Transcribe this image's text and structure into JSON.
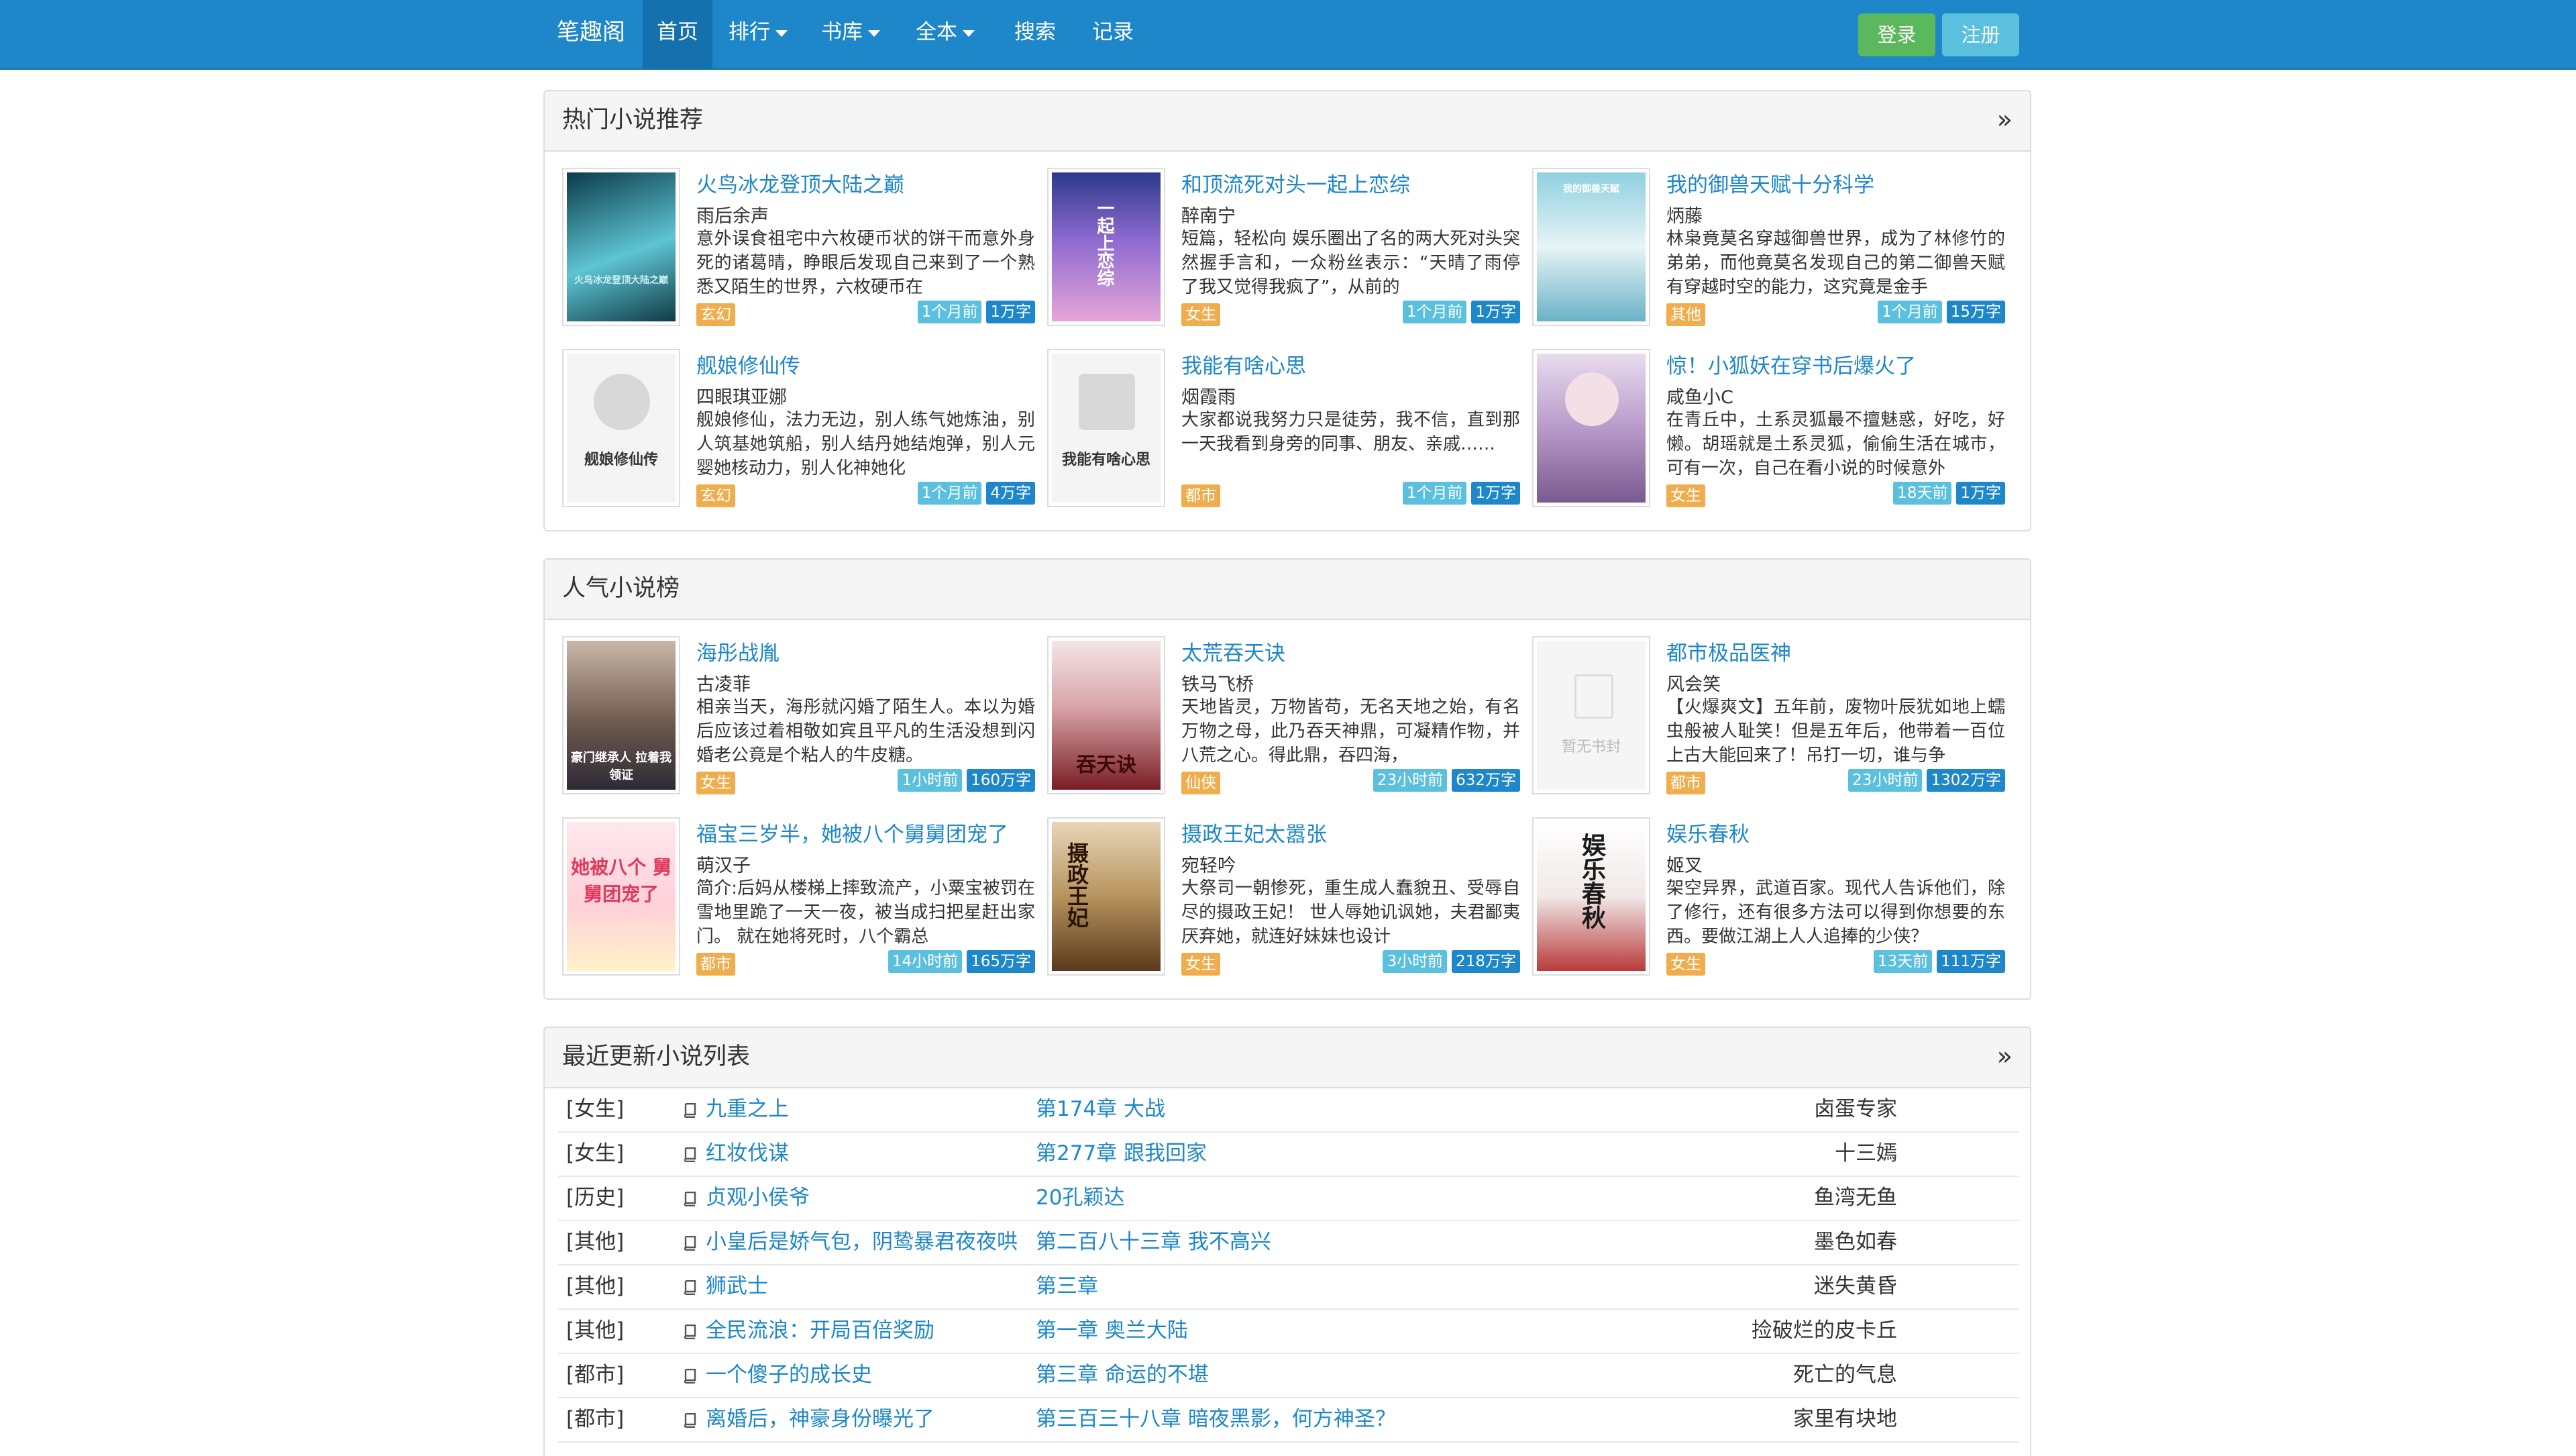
{
  "nav": {
    "brand": "笔趣阁",
    "items": [
      {
        "label": "首页"
      },
      {
        "label": "排行"
      },
      {
        "label": "书库"
      },
      {
        "label": "全本"
      },
      {
        "label": "搜索"
      },
      {
        "label": "记录"
      }
    ],
    "login": "登录",
    "register": "注册"
  },
  "hot": {
    "title": "热门小说推荐",
    "more_icon": "double-chevron-right-icon",
    "books": [
      {
        "title": "火鸟冰龙登顶大陆之巅",
        "author": "雨后余声",
        "intro": "意外误食祖宅中六枚硬币状的饼干而意外身死的诸葛晴，睁眼后发现自己来到了一个熟悉又陌生的世界，六枚硬币在",
        "category": "玄幻",
        "time": "1个月前",
        "words": "1万字"
      },
      {
        "title": "和顶流死对头一起上恋综",
        "author": "醉南宁",
        "intro": "短篇，轻松向 娱乐圈出了名的两大死对头突然握手言和，一众粉丝表示：“天晴了雨停了我又觉得我疯了”，从前的",
        "category": "女生",
        "time": "1个月前",
        "words": "1万字"
      },
      {
        "title": "我的御兽天赋十分科学",
        "author": "炳藤",
        "intro": "林枭竟莫名穿越御兽世界，成为了林修竹的弟弟，而他竟莫名发现自己的第二御兽天赋有穿越时空的能力，这究竟是金手",
        "category": "其他",
        "time": "1个月前",
        "words": "15万字"
      },
      {
        "title": "舰娘修仙传",
        "author": "四眼琪亚娜",
        "intro": "舰娘修仙，法力无边，别人练气她炼油，别人筑基她筑船，别人结丹她结炮弹，别人元婴她核动力，别人化神她化",
        "category": "玄幻",
        "time": "1个月前",
        "words": "4万字"
      },
      {
        "title": "我能有啥心思",
        "author": "烟霞雨",
        "intro": "大家都说我努力只是徒劳，我不信，直到那一天我看到身旁的同事、朋友、亲戚……",
        "category": "都市",
        "time": "1个月前",
        "words": "1万字"
      },
      {
        "title": "惊！小狐妖在穿书后爆火了",
        "author": "咸鱼小C",
        "intro": "在青丘中，土系灵狐最不擅魅惑，好吃，好懒。胡瑶就是土系灵狐，偷偷生活在城市，可有一次，自己在看小说的时候意外",
        "category": "女生",
        "time": "18天前",
        "words": "1万字"
      }
    ]
  },
  "popular": {
    "title": "人气小说榜",
    "books": [
      {
        "title": "海彤战胤",
        "author": "古凌菲",
        "intro": "相亲当天，海彤就闪婚了陌生人。本以为婚后应该过着相敬如宾且平凡的生活没想到闪婚老公竟是个粘人的牛皮糖。",
        "category": "女生",
        "time": "1小时前",
        "words": "160万字"
      },
      {
        "title": "太荒吞天诀",
        "author": "铁马飞桥",
        "intro": "天地皆灵，万物皆苟，无名天地之始，有名万物之母，此乃吞天神鼎，可凝精作物，并八荒之心。得此鼎，吞四海，",
        "category": "仙侠",
        "time": "23小时前",
        "words": "632万字"
      },
      {
        "title": "都市极品医神",
        "author": "风会笑",
        "intro": "【火爆爽文】五年前，废物叶辰犹如地上蠕虫般被人耻笑！但是五年后，他带着一百位上古大能回来了！吊打一切，谁与争",
        "category": "都市",
        "time": "23小时前",
        "words": "1302万字"
      },
      {
        "title": "福宝三岁半，她被八个舅舅团宠了",
        "author": "萌汉子",
        "intro": "简介:后妈从楼梯上摔致流产，小粟宝被罚在雪地里跪了一天一夜，被当成扫把星赶出家门。 就在她将死时，八个霸总",
        "category": "都市",
        "time": "14小时前",
        "words": "165万字"
      },
      {
        "title": "摄政王妃太嚣张",
        "author": "宛轻吟",
        "intro": "大祭司一朝惨死，重生成人蠢貌丑、受辱自尽的摄政王妃！ 世人辱她讥讽她，夫君鄙夷厌弃她，就连好妹妹也设计",
        "category": "女生",
        "time": "3小时前",
        "words": "218万字"
      },
      {
        "title": "娱乐春秋",
        "author": "姬叉",
        "intro": "架空异界，武道百家。现代人告诉他们，除了修行，还有很多方法可以得到你想要的东西。要做江湖上人人追捧的少侠？",
        "category": "女生",
        "time": "13天前",
        "words": "111万字"
      }
    ]
  },
  "recent": {
    "title": "最近更新小说列表",
    "rows": [
      {
        "cat": "[女生]",
        "book": "九重之上",
        "chapter": "第174章 大战",
        "author": "卤蛋专家"
      },
      {
        "cat": "[女生]",
        "book": "红妆伐谋",
        "chapter": "第277章 跟我回家",
        "author": "十三嫣"
      },
      {
        "cat": "[历史]",
        "book": "贞观小侯爷",
        "chapter": "20孔颖达",
        "author": "鱼湾无鱼"
      },
      {
        "cat": "[其他]",
        "book": "小皇后是娇气包，阴鸷暴君夜夜哄",
        "chapter": "第二百八十三章 我不高兴",
        "author": "墨色如春"
      },
      {
        "cat": "[其他]",
        "book": "狮武士",
        "chapter": "第三章",
        "author": "迷失黄昏"
      },
      {
        "cat": "[其他]",
        "book": "全民流浪：开局百倍奖励",
        "chapter": "第一章 奥兰大陆",
        "author": "捡破烂的皮卡丘"
      },
      {
        "cat": "[都市]",
        "book": "一个傻子的成长史",
        "chapter": "第三章 命运的不堪",
        "author": "死亡的气息"
      },
      {
        "cat": "[都市]",
        "book": "离婚后，神豪身份曝光了",
        "chapter": "第三百三十八章 暗夜黑影，何方神圣？",
        "author": "家里有块地"
      }
    ]
  },
  "colors": {
    "navbar": "#1e87c9",
    "link": "#1e87c9",
    "category_tag": "#f0ad4e",
    "login_button": "#5cb85c",
    "register_button": "#5bc0de"
  }
}
